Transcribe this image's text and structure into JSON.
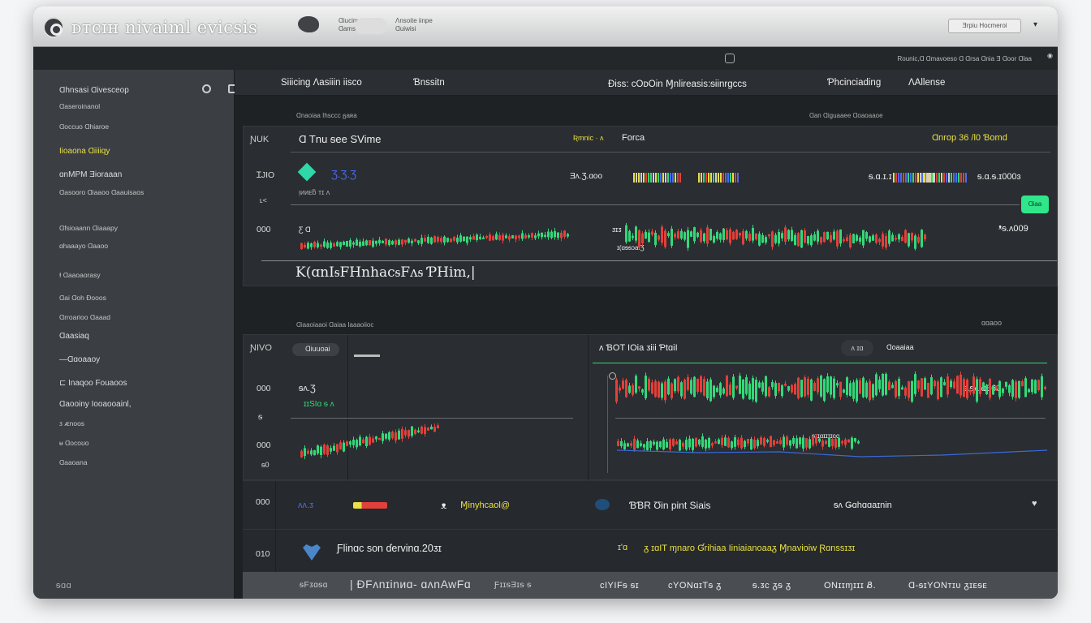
{
  "window": {
    "title": "ᴅᴛᴄɪʜ nivaiml evicsis",
    "toolbar_group_1": [
      "Ɑiuciny",
      "Ɑamsei"
    ],
    "toolbar_group_2": [
      "Ʌnsoite iinpe",
      "Ɑuiwisi"
    ],
    "toolbar_button": "Ǝrpiu Hocmeroi"
  },
  "status_strip": {
    "text": "Rounic,Ɑ Ɑmavoeso Ɑ Ɑrsa Ɑnia Ǝ Ɑoor Ɑlaa"
  },
  "sidebar": {
    "header": "Ɑhnsasi Ɑivesceop",
    "items": [
      {
        "label": "Ɑaseroinanol",
        "style": "small"
      },
      {
        "label": "Ɑoccuo Ɑhiaroe",
        "style": "small"
      },
      {
        "label": "Iioaona Ɑiiiiqy",
        "style": "active"
      },
      {
        "label": "ɑnMPM Ǝioraaan",
        "style": "normal"
      },
      {
        "label": "Ɑasooro Ɑiaaoo Ɑaauisaos",
        "style": "small"
      },
      {
        "label": "Ɑfsioaann Ɑiaaapy",
        "style": "small"
      },
      {
        "label": "ɑhaaayo Ɑaaoo",
        "style": "small"
      },
      {
        "label": "Ɨ Ɑaaoaorasy",
        "style": "small"
      },
      {
        "label": "Ɑai Ɑoh Ɖooos",
        "style": "small"
      },
      {
        "label": "Ɑrroarioo Ɑaaad",
        "style": "small"
      },
      {
        "label": "Ɑaasiaq",
        "style": "normal"
      },
      {
        "label": "—Ɑɑoaaoy",
        "style": "normal"
      },
      {
        "label": "⊏ Inaqoo Fouaoos",
        "style": "normal"
      },
      {
        "label": "Ɑaooiny Iooaooainl,",
        "style": "normal"
      },
      {
        "label": "ᴣ ᴁnoos",
        "style": "small"
      },
      {
        "label": "ᵾ Ɑocoʊo",
        "style": "small"
      },
      {
        "label": "Ɑaaoana",
        "style": "small"
      }
    ]
  },
  "topnav": {
    "items": [
      "Siiicing Ʌasiiin iisco",
      "Ɓnssitn",
      "Ɖiss: ᴄOᴅOin Ɱnlireasis:ᵴiinrgccs",
      "Ƥhcinciading",
      "ɅAllense"
    ]
  },
  "panel1": {
    "pre_label": "Ɑnaoiaa Ihsccc ᵷaʀa",
    "right_pre_label": "Ɑan Ɑiguaaee Ɑoaoaaoe",
    "left_tag": "ƝUK",
    "title": "Ɑ Tnu ᵴee SVime",
    "mid_label": "Ʀmnic · ᴧ",
    "mid_value": "Forca",
    "right_label": "Ɑnrop 36 /l0 Ɓomd",
    "y_labels": [
      "ꞮJIO",
      "ʟ<",
      "000"
    ],
    "price_1": "Ʒ.Ʒ.Ʒ",
    "sub_1": "ᴉᴎᴎᴇƃ ᴛɪ ᴧ",
    "val_mid": "Ǝᴧ.Ʒ.ɑoo",
    "val_mid_2": "ɑɪɪɪɑ.Ʒ.0ɣ",
    "val_right_1": "ᵴ.ɑ.ɪ.ɪ",
    "val_right_2": "ᵴ.ɑ.ᵴ.ɪ000ɜ",
    "val_right_3": "ᵜᵴ.ᴧ009",
    "green_pill": "Ɑiaa",
    "legend_line": "K(ɑnIᵴFHnhacᵴFᴧᵴ ƤHim,|",
    "small_labels": [
      "Ƹ Ɑ",
      "ᴣɪᴣ",
      "ɪ(ɑᵴᵴɔa.Ʒ"
    ]
  },
  "section2": {
    "label": "Ɑiaaoiaaoi Ɑaiaa Iaaaoiioc",
    "right_label": "ɑɑaoo"
  },
  "panel2": {
    "left_tag": "ƝIVO",
    "chip": "Ɑiuuoai",
    "mid_title": "ᴧ ƁOT IOia ᴣiii ƤtɑiI",
    "mid_chip": "ᴧ ɪɑ",
    "right_label": "Ɑoaaiaa",
    "y_labels": [
      "000",
      "ᵴ",
      "000",
      "ᵴ0"
    ],
    "price": "ᵴᴧ.Ʒ",
    "sub": "ɪɪSIɑ ᵴ ᴧ",
    "right_price": "ᵴ.ᵴᴧᴧɪ360",
    "tiny_label": "ᵴɪɪɑɪɪɪɪoɑ"
  },
  "row1": {
    "y_label": "000",
    "left_value": "ᴧᴧ.ᴣ",
    "mid_text": "Ɱinyhcaol@",
    "mid_prefix": "ᴥ",
    "bbr_text": "ƁƁR Ʊin pint Siais",
    "right_text": "ᵴᴧ Ǥɑhɑɑaɪnin"
  },
  "row2": {
    "y_label": "010",
    "text": "Ƒlinɑc son ɗervinɑ.20ᴣɪ",
    "mid_text": "ɪ'ɑ",
    "yellow_text": "ᵹ ɪɑIT ɱnaro Ɠrihiaa Iiniaianoaaᵹ  Ɱnavioiw Ɽɑnssɪᴣɪ"
  },
  "footer": {
    "items": [
      "ᵴFᴣɑᵴɑ",
      "| ƉFᴧnɪinᴎɑ- ɑʌnAwFɑ",
      "ƑɪɪᵴƎɪᵴ ᵴ",
      "ᴄIYIFᵴ ᵴɪ",
      "ᴄYONɑɪTᵴ ᵹ",
      "ᵴ.ᴣᴄ ᵹᵴ ᵹ",
      "ONɪɪɱɪɪɪ Ᏸ.",
      "Ɑ-ᵴɪYONᴛɪᴜ ᵹɪᴇᵴᴇ"
    ],
    "y_label": "ᵴɑɑ"
  },
  "colors": {
    "accent_yellow": "#e8e045",
    "candle_green": "#34d87a",
    "candle_red": "#e2403a",
    "window_bg": "#26292c"
  }
}
